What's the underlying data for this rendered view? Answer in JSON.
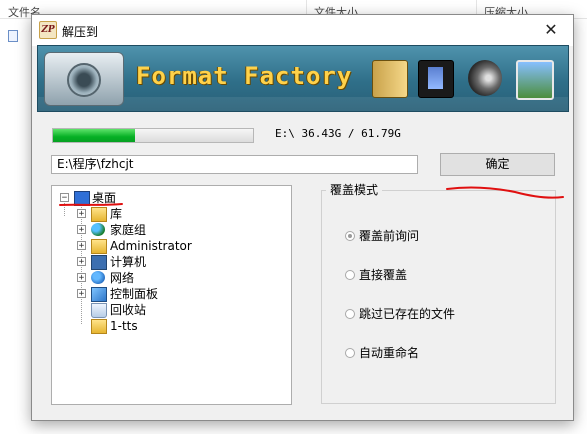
{
  "background": {
    "col_filename": "文件名",
    "col_size": "文件大小",
    "col_compressed": "压缩大小"
  },
  "dialog": {
    "title": "解压到",
    "close_glyph": "✕",
    "app_icon_text": "ZP"
  },
  "banner": {
    "title": "Format Factory"
  },
  "progress": {
    "fraction": 0.41,
    "drive_info": "E:\\  36.43G / 61.79G"
  },
  "path": {
    "value": "E:\\程序\\fzhcjt"
  },
  "ok_button": "确定",
  "tree": {
    "items": [
      {
        "label": "桌面",
        "expander": "−",
        "icon": "desktop-icon"
      },
      {
        "label": "库",
        "expander": "+",
        "icon": "library-icon"
      },
      {
        "label": "家庭组",
        "expander": "+",
        "icon": "homegroup-icon"
      },
      {
        "label": "Administrator",
        "expander": "+",
        "icon": "user-folder-icon"
      },
      {
        "label": "计算机",
        "expander": "+",
        "icon": "computer-icon"
      },
      {
        "label": "网络",
        "expander": "+",
        "icon": "network-icon"
      },
      {
        "label": "控制面板",
        "expander": "+",
        "icon": "control-panel-icon"
      },
      {
        "label": "回收站",
        "expander": "",
        "icon": "recycle-bin-icon"
      },
      {
        "label": "1-tts",
        "expander": "",
        "icon": "folder-icon"
      }
    ]
  },
  "overwrite": {
    "title": "覆盖模式",
    "options": [
      {
        "label": "覆盖前询问",
        "selected": true
      },
      {
        "label": "直接覆盖",
        "selected": false
      },
      {
        "label": "跳过已存在的文件",
        "selected": false
      },
      {
        "label": "自动重命名",
        "selected": false
      }
    ]
  },
  "colors": {
    "progress_green": "#06b025",
    "annotation_red": "#e01010",
    "banner_teal": "#2f6f89",
    "banner_title_yellow": "#ffd24a"
  }
}
